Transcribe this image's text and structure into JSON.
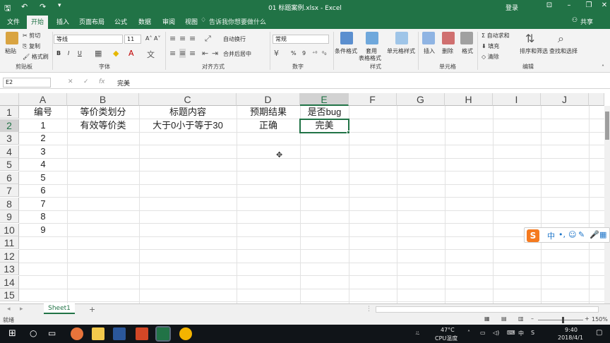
{
  "titlebar": {
    "save_icon": "save-icon",
    "undo_icon": "undo-icon",
    "redo_icon": "redo-icon",
    "document_title": "01 标题案例.xlsx  -  Excel",
    "login": "登录"
  },
  "tabs": {
    "items": [
      "文件",
      "开始",
      "插入",
      "页面布局",
      "公式",
      "数据",
      "审阅",
      "视图"
    ],
    "tell_me": "告诉我你想要做什么",
    "share": "共享"
  },
  "ribbon": {
    "clipboard": {
      "paste": "粘贴",
      "cut": "剪切",
      "copy": "复制",
      "format_painter": "格式刷",
      "group": "剪贴板"
    },
    "font": {
      "font_name": "等线",
      "font_size": "11",
      "bold": "B",
      "italic": "I",
      "underline": "U",
      "group": "字体"
    },
    "alignment": {
      "wrap_text": "自动换行",
      "merge_center": "合并后居中",
      "group": "对齐方式"
    },
    "number": {
      "format": "常规",
      "percent": "%",
      "comma": "9",
      "group": "数字"
    },
    "styles": {
      "conditional": "条件格式",
      "table_format_1": "套用",
      "table_format_2": "表格格式",
      "cell_styles": "单元格样式",
      "group": "样式"
    },
    "cells": {
      "insert": "插入",
      "delete": "删除",
      "format": "格式",
      "group": "单元格"
    },
    "editing": {
      "autosum": "自动求和",
      "fill": "填充",
      "clear": "清除",
      "sort_filter": "排序和筛选",
      "find_select": "查找和选择",
      "group": "编辑"
    }
  },
  "formula_bar": {
    "name_box": "E2",
    "fx": "fx",
    "value": "完美"
  },
  "grid": {
    "columns": [
      "A",
      "B",
      "C",
      "D",
      "E",
      "F",
      "G",
      "H",
      "I",
      "J"
    ],
    "rows": [
      "1",
      "2",
      "3",
      "4",
      "5",
      "6",
      "7",
      "8",
      "9",
      "10",
      "11",
      "12",
      "13",
      "14",
      "15"
    ],
    "cells": {
      "A1": "编号",
      "B1": "等价类划分",
      "C1": "标题内容",
      "D1": "预期结果",
      "E1": "是否bug",
      "A2": "1",
      "B2": "有效等价类",
      "C2": "大于0小于等于30",
      "D2": "正确",
      "E2": "完美",
      "A3": "2",
      "A4": "3",
      "A5": "4",
      "A6": "5",
      "A7": "6",
      "A8": "7",
      "A9": "8",
      "A10": "9"
    },
    "selected_cell": "E2"
  },
  "sheets": {
    "tabs": [
      "Sheet1"
    ],
    "add": "+"
  },
  "statusbar": {
    "ready": "就绪",
    "zoom": "150%"
  },
  "ime": {
    "logo": "S",
    "mode": "中"
  },
  "taskbar": {
    "temperature": "47°C",
    "temp_label": "CPU温度",
    "ime_lang": "中",
    "time": "9:40",
    "date": "2018/4/1"
  },
  "colors": {
    "excel_green": "#217346",
    "selection": "#217346",
    "taskbar": "#101418"
  }
}
